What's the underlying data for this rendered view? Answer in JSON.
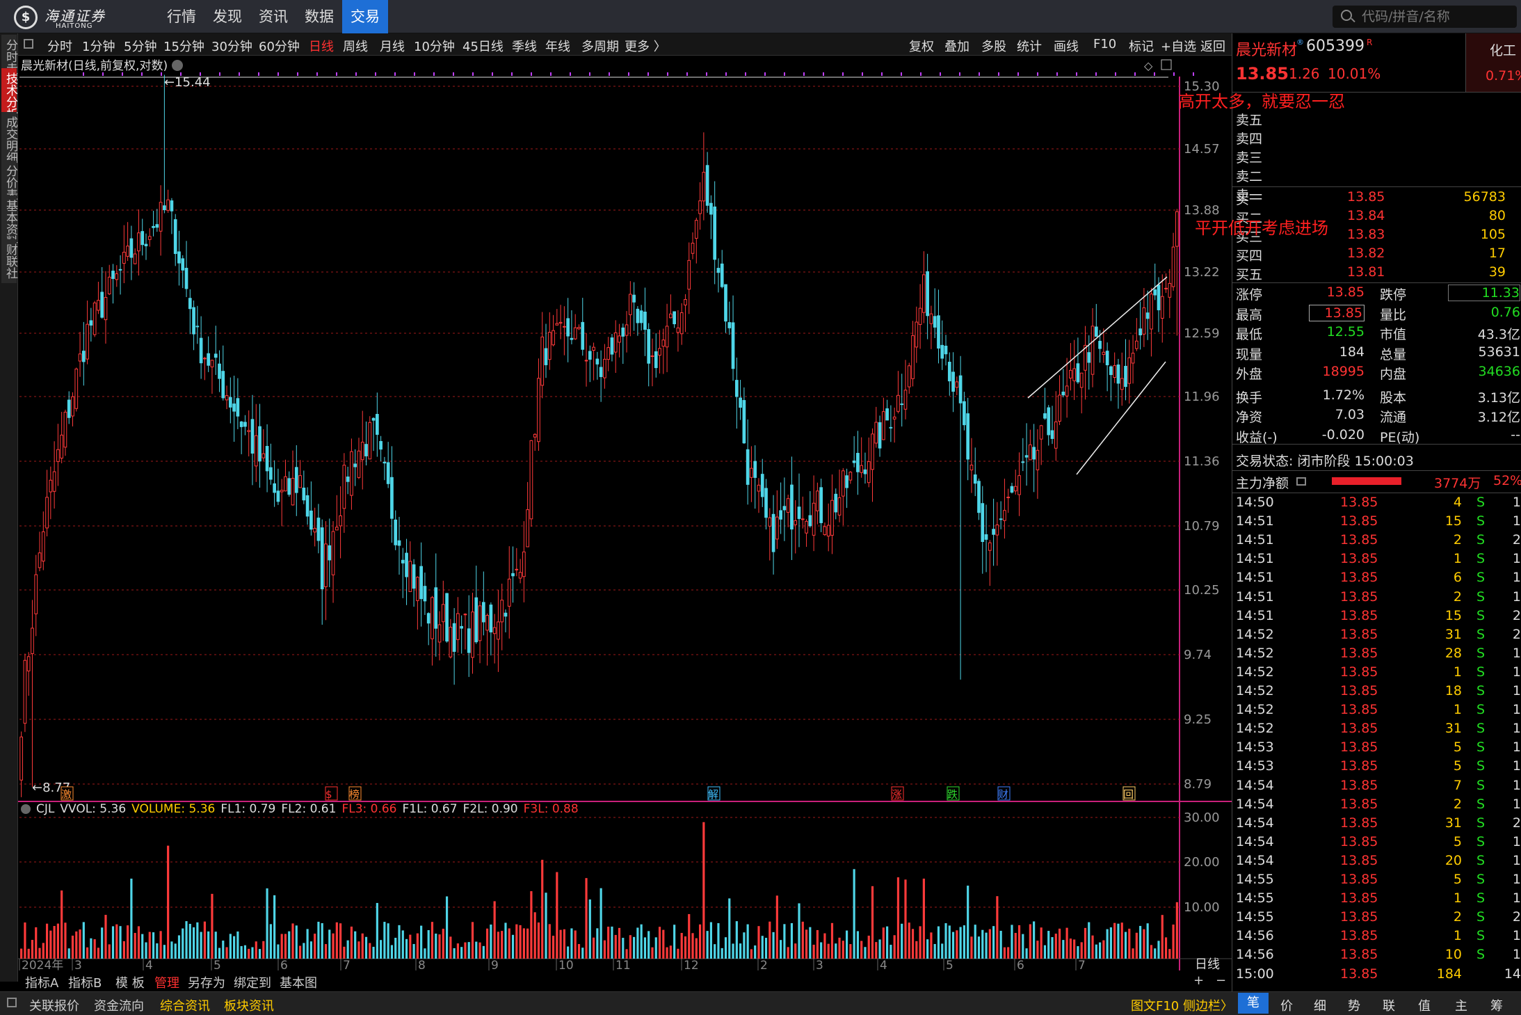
{
  "app": {
    "logo_text": "海通证券",
    "logo_en": "HAITONG"
  },
  "nav": [
    "行情",
    "发现",
    "资讯",
    "数据",
    "交易"
  ],
  "search": {
    "placeholder": "代码/拼音/名称"
  },
  "left_tabs": [
    "分时走势",
    "技术分析",
    "成交明细",
    "分价表",
    "基本资料",
    "财联社"
  ],
  "periods": [
    "分时",
    "1分钟",
    "5分钟",
    "15分钟",
    "30分钟",
    "60分钟",
    "日线",
    "周线",
    "月线",
    "10分钟",
    "45日线",
    "季线",
    "年线",
    "多周期",
    "更多 〉"
  ],
  "active_period": "日线",
  "tools": [
    "复权",
    "叠加",
    "多股",
    "统计",
    "画线",
    "F10",
    "标记",
    "+自选",
    "返回"
  ],
  "chart_title": "晨光新材(日线,前复权,对数)",
  "price_axis": [
    "15.30",
    "14.57",
    "13.88",
    "13.22",
    "12.59",
    "11.96",
    "11.36",
    "10.79",
    "10.25",
    "9.74",
    "9.25",
    "8.79"
  ],
  "vol_axis": [
    "30.00",
    "20.00",
    "10.00"
  ],
  "x_labels": [
    "2024年",
    "3",
    "4",
    "5",
    "6",
    "7",
    "8",
    "9",
    "10",
    "11",
    "12",
    "2",
    "3",
    "4",
    "5",
    "6",
    "7"
  ],
  "high_mark": "15.44",
  "low_mark": "8.77",
  "event_markers": [
    {
      "t": "激",
      "c": "#ff8c30"
    },
    {
      "t": "$",
      "c": "#ff3030"
    },
    {
      "t": "榜",
      "c": "#ff8c30"
    },
    {
      "t": "解",
      "c": "#40c0ff"
    },
    {
      "t": "涨",
      "c": "#ff3030"
    },
    {
      "t": "跌",
      "c": "#30dd30"
    },
    {
      "t": "财",
      "c": "#4080ff"
    },
    {
      "t": "回",
      "c": "#ffcc66"
    }
  ],
  "vol_header": [
    {
      "t": "CJL",
      "c": "#dddddd"
    },
    {
      "t": "VVOL: 5.36",
      "c": "#dddddd"
    },
    {
      "t": "VOLUME: 5.36",
      "c": "#ffcc00"
    },
    {
      "t": "FL1: 0.79",
      "c": "#dddddd"
    },
    {
      "t": "FL2: 0.61",
      "c": "#dddddd"
    },
    {
      "t": "FL3: 0.66",
      "c": "#ff3333"
    },
    {
      "t": "F1L: 0.67",
      "c": "#dddddd"
    },
    {
      "t": "F2L: 0.90",
      "c": "#dddddd"
    },
    {
      "t": "F3L: 0.88",
      "c": "#ff3333"
    }
  ],
  "annotations": [
    "高开太多，就要忍一忍",
    "平开低开考虑进场"
  ],
  "stock": {
    "name": "晨光新材",
    "code": "605399",
    "superscript": "R",
    "price": "13.85",
    "change": "1.26",
    "pct": "10.01%",
    "industry": "化工",
    "industry_pct": "0.71%"
  },
  "sell": [
    {
      "label": "卖五",
      "p": "",
      "v": ""
    },
    {
      "label": "卖四",
      "p": "",
      "v": ""
    },
    {
      "label": "卖三",
      "p": "",
      "v": ""
    },
    {
      "label": "卖二",
      "p": "",
      "v": ""
    },
    {
      "label": "卖一",
      "p": "",
      "v": ""
    }
  ],
  "buy": [
    {
      "label": "买一",
      "p": "13.85",
      "v": "56783"
    },
    {
      "label": "买二",
      "p": "13.84",
      "v": "80"
    },
    {
      "label": "买三",
      "p": "13.83",
      "v": "105"
    },
    {
      "label": "买四",
      "p": "13.82",
      "v": "17"
    },
    {
      "label": "买五",
      "p": "13.81",
      "v": "39"
    }
  ],
  "stats": [
    {
      "l": "涨停",
      "v": "13.85",
      "vc": "red",
      "l2": "跌停",
      "v2": "11.33",
      "v2c": "green"
    },
    {
      "l": "最高",
      "v": "13.85",
      "vc": "red",
      "l2": "量比",
      "v2": "0.76",
      "v2c": "green"
    },
    {
      "l": "最低",
      "v": "12.55",
      "vc": "green",
      "l2": "市值",
      "v2": "43.3亿",
      "v2c": "white"
    },
    {
      "l": "现量",
      "v": "184",
      "vc": "white",
      "l2": "总量",
      "v2": "53631",
      "v2c": "white"
    },
    {
      "l": "外盘",
      "v": "18995",
      "vc": "red",
      "l2": "内盘",
      "v2": "34636",
      "v2c": "green"
    },
    {
      "l": "换手",
      "v": "1.72%",
      "vc": "white",
      "l2": "股本",
      "v2": "3.13亿",
      "v2c": "white"
    },
    {
      "l": "净资",
      "v": "7.03",
      "vc": "white",
      "l2": "流通",
      "v2": "3.12亿",
      "v2c": "white"
    },
    {
      "l": "收益(-)",
      "v": "-0.020",
      "vc": "white",
      "l2": "PE(动)",
      "v2": "--",
      "v2c": "white"
    }
  ],
  "trade_status": "交易状态: 闭市阶段 15:00:03",
  "main_flow": {
    "label": "主力净额",
    "value": "3774万",
    "pct": "52%"
  },
  "ticks": [
    [
      "14:50",
      "13.85",
      "4",
      "S",
      "1"
    ],
    [
      "14:51",
      "13.85",
      "15",
      "S",
      "1"
    ],
    [
      "14:51",
      "13.85",
      "2",
      "S",
      "2"
    ],
    [
      "14:51",
      "13.85",
      "1",
      "S",
      "1"
    ],
    [
      "14:51",
      "13.85",
      "6",
      "S",
      "1"
    ],
    [
      "14:51",
      "13.85",
      "2",
      "S",
      "1"
    ],
    [
      "14:51",
      "13.85",
      "15",
      "S",
      "2"
    ],
    [
      "14:52",
      "13.85",
      "31",
      "S",
      "2"
    ],
    [
      "14:52",
      "13.85",
      "28",
      "S",
      "1"
    ],
    [
      "14:52",
      "13.85",
      "1",
      "S",
      "1"
    ],
    [
      "14:52",
      "13.85",
      "18",
      "S",
      "1"
    ],
    [
      "14:52",
      "13.85",
      "1",
      "S",
      "1"
    ],
    [
      "14:52",
      "13.85",
      "31",
      "S",
      "1"
    ],
    [
      "14:53",
      "13.85",
      "5",
      "S",
      "1"
    ],
    [
      "14:53",
      "13.85",
      "5",
      "S",
      "1"
    ],
    [
      "14:54",
      "13.85",
      "7",
      "S",
      "1"
    ],
    [
      "14:54",
      "13.85",
      "2",
      "S",
      "1"
    ],
    [
      "14:54",
      "13.85",
      "31",
      "S",
      "2"
    ],
    [
      "14:54",
      "13.85",
      "5",
      "S",
      "1"
    ],
    [
      "14:54",
      "13.85",
      "20",
      "S",
      "1"
    ],
    [
      "14:55",
      "13.85",
      "5",
      "S",
      "1"
    ],
    [
      "14:55",
      "13.85",
      "1",
      "S",
      "1"
    ],
    [
      "14:55",
      "13.85",
      "2",
      "S",
      "2"
    ],
    [
      "14:56",
      "13.85",
      "1",
      "S",
      "1"
    ],
    [
      "14:56",
      "13.85",
      "10",
      "S",
      "1"
    ],
    [
      "15:00",
      "13.85",
      "184",
      "",
      "14"
    ]
  ],
  "bottom1": [
    "指标A",
    "指标B",
    "模 板",
    "管理",
    "另存为",
    "绑定到",
    "基本图"
  ],
  "bottom2": [
    "关联报价",
    "资金流向",
    "综合资讯",
    "板块资讯"
  ],
  "bottom_right_link": "图文F10 侧边栏〉",
  "bottom_tabs": [
    "笔",
    "价",
    "细",
    "势",
    "联",
    "值",
    "主",
    "筹"
  ],
  "daily_label": "日线"
}
